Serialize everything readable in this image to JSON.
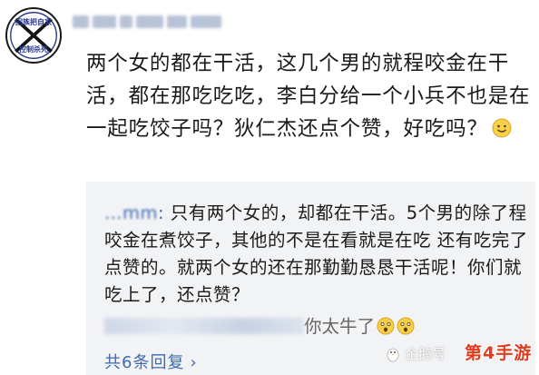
{
  "post": {
    "avatar_seal_top": "回族把自家",
    "avatar_seal_bottom": "控制杀死",
    "text": "两个女的都在干活，这几个男的就程咬金在干活，都在那吃吃吃，李白分给一个小兵不也是在一起吃饺子吗？狄仁杰还点个赞，好吃吗？",
    "smiley_icon": "smiley-icon"
  },
  "reply": {
    "username": "…mm",
    "colon": ":",
    "text": " 只有两个女的，却都在干活。5个男的除了程咬金在煮饺子，其他的不是在看就是在吃 还有吃完了点赞的。就两个女的还在那勤勤恳恳干活呢！你们就吃上了，还点赞？",
    "second_reply_text": "你太牛了",
    "view_more": "共6条回复",
    "view_more_icon": "chevron-right-icon"
  },
  "watermark": {
    "source": "企鹅号",
    "brand": "第4手游"
  },
  "colors": {
    "link": "#3d6bb3",
    "reply_bg": "#f2f3f5",
    "brand_red": "#e23a1f"
  }
}
